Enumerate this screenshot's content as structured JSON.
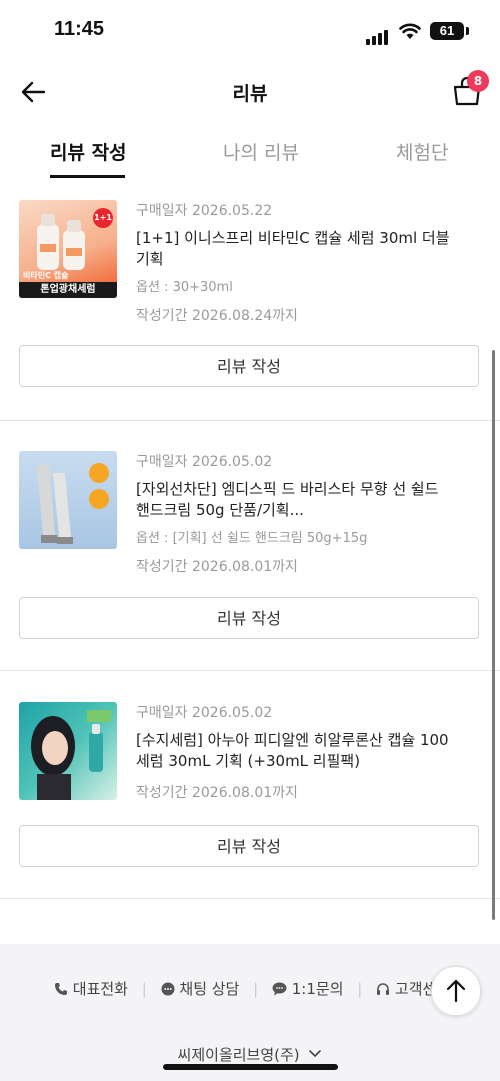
{
  "status_bar": {
    "time": "11:45",
    "battery": "61"
  },
  "header": {
    "title": "리뷰",
    "cart_count": "8"
  },
  "tabs": [
    {
      "label": "리뷰 작성",
      "active": true
    },
    {
      "label": "나의 리뷰",
      "active": false
    },
    {
      "label": "체험단",
      "active": false
    }
  ],
  "orders": [
    {
      "date": "구매일자 2026.05.22",
      "name": "[1+1] 이니스프리 비타민C 캡슐 세럼 30ml 더블 기획",
      "option": "옵션 : 30+30ml",
      "period": "작성기간 2026.08.24까지",
      "button": "리뷰 작성",
      "thumb_text": [
        "1+1",
        "비타민C 캡슐",
        "톤업광채세럼"
      ]
    },
    {
      "date": "구매일자 2026.05.02",
      "name": "[자외선차단] 엠디스픽 드 바리스타 무향 선 쉴드 핸드크림 50g 단품/기획...",
      "option": "옵션 : [기획] 선 쉴드 핸드크림 50g+15g",
      "period": "작성기간 2026.08.01까지",
      "button": "리뷰 작성"
    },
    {
      "date": "구매일자 2026.05.02",
      "name": "[수지세럼] 아누아 피디알엔 히알루론산 캡슐 100 세럼 30mL 기획 (+30mL 리필팩)",
      "option": "",
      "period": "작성기간 2026.08.01까지",
      "button": "리뷰 작성"
    }
  ],
  "footer": {
    "links": [
      "대표전화",
      "채팅 상담",
      "1:1문의",
      "고객센"
    ],
    "company": "씨제이올리브영(주)"
  },
  "colors": {
    "badge": "#f0385a",
    "accent_orange": "#f0561f"
  }
}
